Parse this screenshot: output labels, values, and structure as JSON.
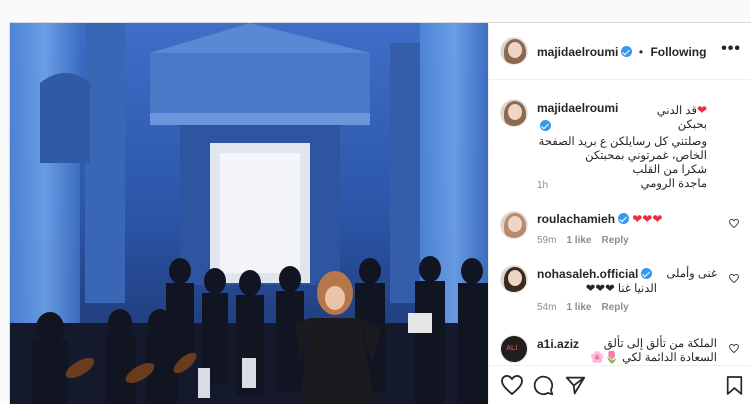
{
  "post": {
    "username": "majidaelroumi",
    "follow_label": "Following",
    "more_label": "•••",
    "caption_lines": [
      "قد الدني بحبكن",
      "وصلتني كل رسايلكن ع بريد الصفحة",
      "الخاص، غمرتوني بمحبتكن",
      "شكرا من القلب",
      "ماجدة الرومي"
    ],
    "time": "1h"
  },
  "comments": [
    {
      "username": "roulachamieh",
      "text": "❤❤❤",
      "time": "59m",
      "likes": "1 like",
      "reply": "Reply"
    },
    {
      "username": "nohasaleh.official",
      "text": "غنى وأملى",
      "text2": "الدنيا غنا ❤❤❤",
      "time": "54m",
      "likes": "1 like",
      "reply": "Reply"
    },
    {
      "username": "a1i.aziz",
      "text": "الملكة من تألق إلى تألق",
      "text2": "السعادة الدائمة لكي 🌷🌸",
      "avatar_text": "ALI"
    }
  ],
  "colors": {
    "verified": "#3897f0",
    "heart": "#ed2b3c",
    "stage_blue": "#2a4d94"
  },
  "icons": [
    "heart-icon",
    "comment-icon",
    "share-icon",
    "bookmark-icon",
    "more-icon"
  ]
}
